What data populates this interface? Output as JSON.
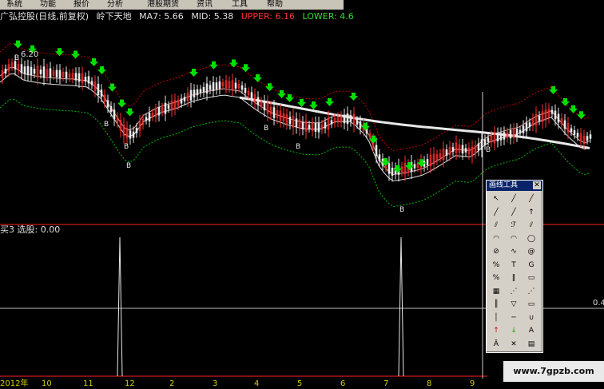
{
  "menu": [
    "系统",
    "功能",
    "报价",
    "分析",
    "港股期货",
    "资讯",
    "工具",
    "帮助"
  ],
  "chart_title": {
    "stock": "广弘控股(日线,前复权)",
    "indicator": "岭下天地",
    "ma7": "MA7: 5.66",
    "mid": "MID: 5.38",
    "upper": "UPPER: 6.16",
    "lower": "LOWER: 4.6"
  },
  "main_chart": {
    "price_marker": "6.20",
    "b_labels": [
      "B",
      "B",
      "B",
      "B",
      "B",
      "B",
      "B",
      "B"
    ]
  },
  "sub_chart": {
    "label": "买3  选股: 0.00",
    "right_value": "0.4"
  },
  "toolbox": {
    "title": "画线工具",
    "tools": [
      "select-arrow",
      "line",
      "ray",
      "segment",
      "extend",
      "up-arrow",
      "parallel",
      "fibonacci",
      "channel",
      "gann",
      "arc",
      "circle",
      "ellipse",
      "sine",
      "spiral",
      "price-label",
      "text",
      "gold-ratio",
      "percent",
      "period",
      "box",
      "grid",
      "fan",
      "speed-line",
      "time-zone",
      "triangle",
      "rect",
      "vline",
      "hline",
      "cycle",
      "up-mark",
      "down-mark",
      "text-a",
      "text-a2",
      "delete",
      "paint",
      "save"
    ]
  },
  "date_axis": [
    "2012年",
    "10",
    "11",
    "12",
    "2",
    "3",
    "4",
    "5",
    "6",
    "7",
    "8",
    "9"
  ],
  "colors": {
    "up": "#ff3030",
    "down": "#e8e8e8",
    "arrow": "#00e000",
    "upper_band": "#c00000",
    "lower_band": "#00c000",
    "ma": "#e0e0e0"
  },
  "watermark": "www.7gpzb.com"
}
